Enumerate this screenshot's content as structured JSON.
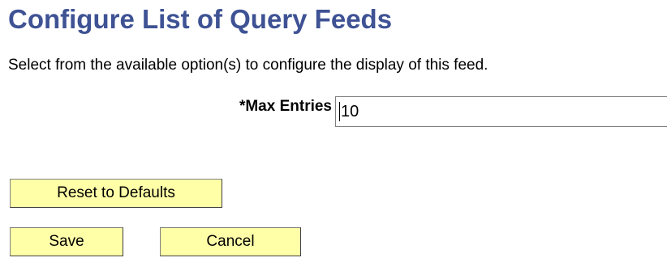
{
  "theme": {
    "title_color": "#3E5294",
    "button_bg": "#FFFFA8"
  },
  "page": {
    "title": "Configure List of Query Feeds",
    "instructions": "Select from the available option(s) to configure the display of this feed."
  },
  "form": {
    "max_entries_label": "*Max Entries",
    "max_entries_value": "10"
  },
  "buttons": {
    "reset_label": "Reset to Defaults",
    "save_label": "Save",
    "cancel_label": "Cancel"
  }
}
